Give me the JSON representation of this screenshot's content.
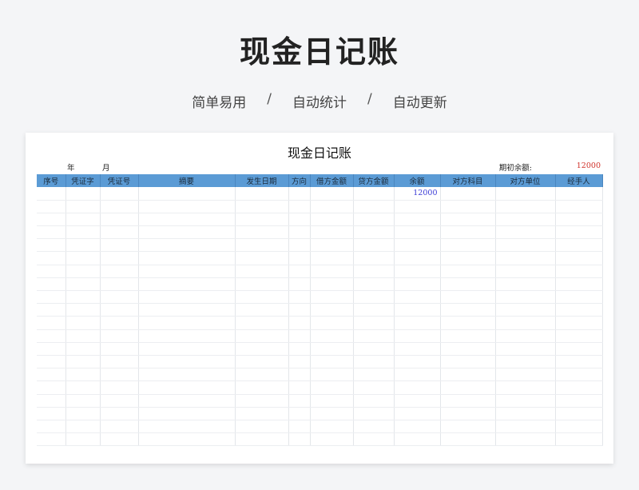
{
  "hero": {
    "title": "现金日记账",
    "features": [
      "简单易用",
      "自动统计",
      "自动更新"
    ],
    "separator": "/"
  },
  "sheet": {
    "title": "现金日记账",
    "year_label": "年",
    "month_label": "月",
    "opening_balance_label": "期初余额:",
    "opening_balance_value": "12000",
    "columns": [
      "序号",
      "凭证字",
      "凭证号",
      "摘要",
      "发生日期",
      "方向",
      "借方金额",
      "贷方金额",
      "余额",
      "对方科目",
      "对方单位",
      "经手人"
    ],
    "rows": [
      [
        "",
        "",
        "",
        "",
        "",
        "",
        "",
        "",
        "12000",
        "",
        "",
        ""
      ]
    ],
    "empty_row_count": 19
  },
  "colors": {
    "header_bg": "#5b9bd5",
    "opening_value": "#d1342c",
    "balance_value": "#3d3dd6"
  }
}
